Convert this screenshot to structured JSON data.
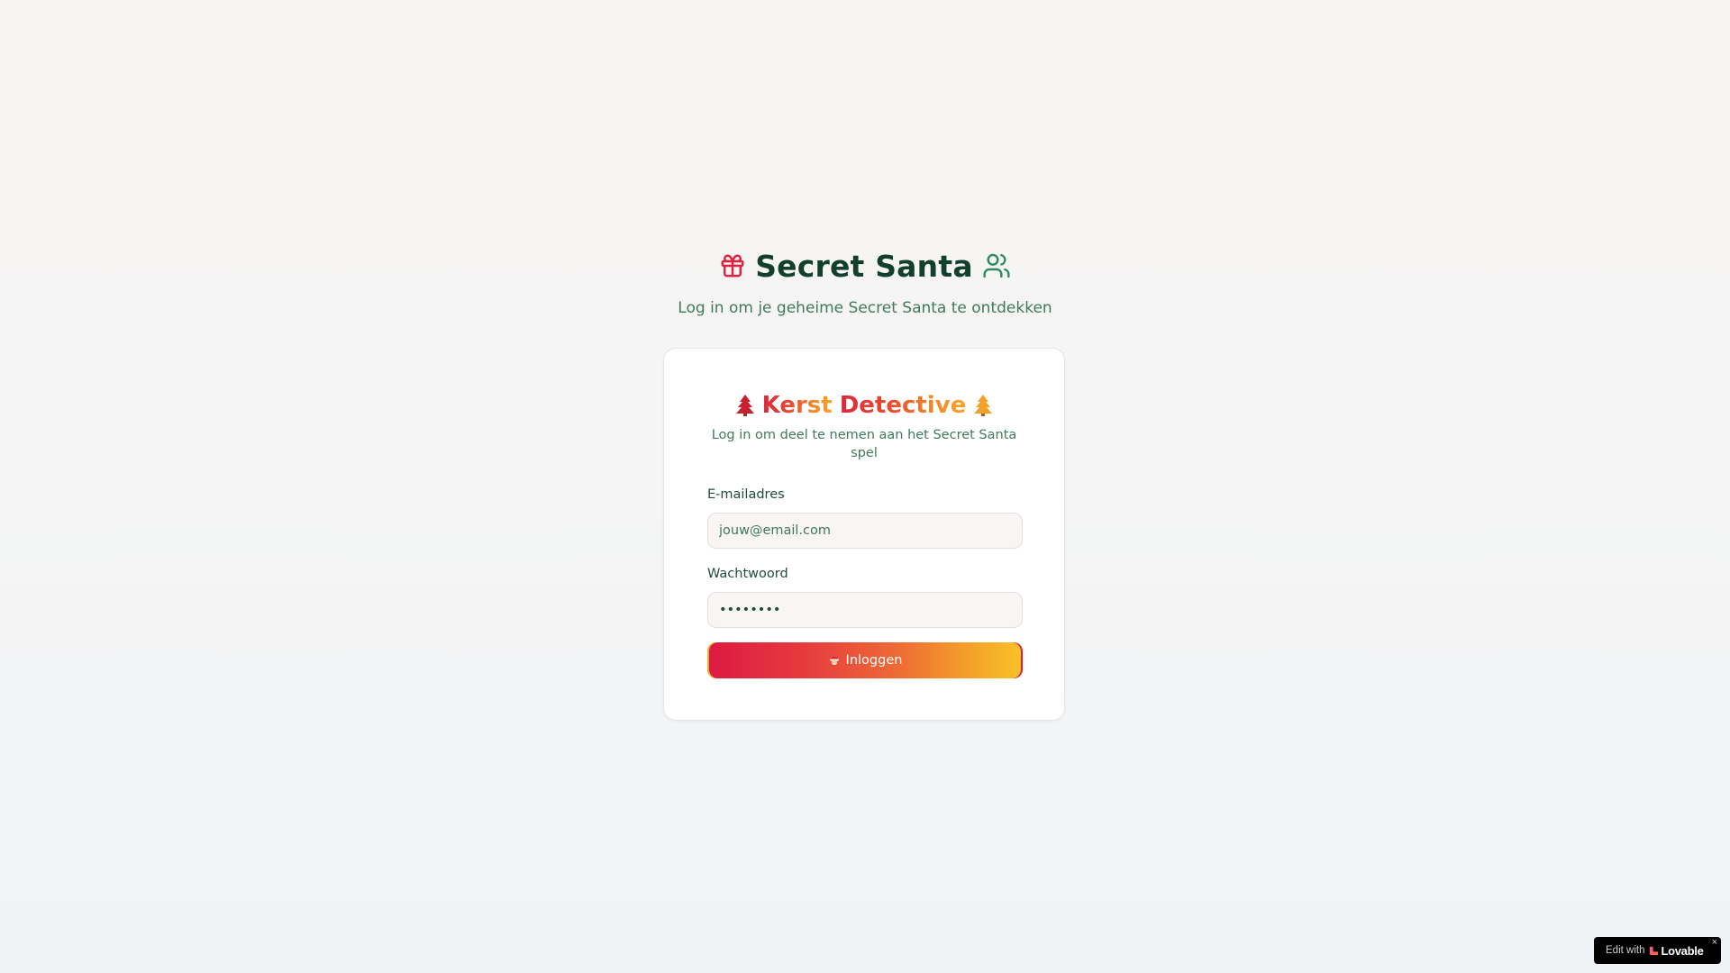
{
  "header": {
    "title": "Secret Santa",
    "subtitle": "Log in om je geheime Secret Santa te ontdekken",
    "left_icon": "gift-icon",
    "right_icon": "users-icon"
  },
  "card": {
    "title_word1": "Kerst",
    "title_word2": "Detective",
    "title_icons": [
      "christmas-tree-icon",
      "christmas-tree-icon"
    ],
    "subtitle": "Log in om deel te nemen aan het Secret Santa spel",
    "email": {
      "label": "E-mailadres",
      "placeholder": "jouw@email.com",
      "value": ""
    },
    "password": {
      "label": "Wachtwoord",
      "value": "••••••••"
    },
    "login_button": {
      "label": "Inloggen",
      "icon": "santa-icon"
    }
  },
  "badge": {
    "prefix": "Edit with",
    "brand": "Lovable",
    "close": "×"
  },
  "colors": {
    "title": "#123f2e",
    "subtitle": "#3e7a5e",
    "gift_icon": "#e0233f",
    "users_icon": "#2e8a60",
    "button_gradient_start": "#dc1a42",
    "button_gradient_end": "#f8c22a"
  }
}
